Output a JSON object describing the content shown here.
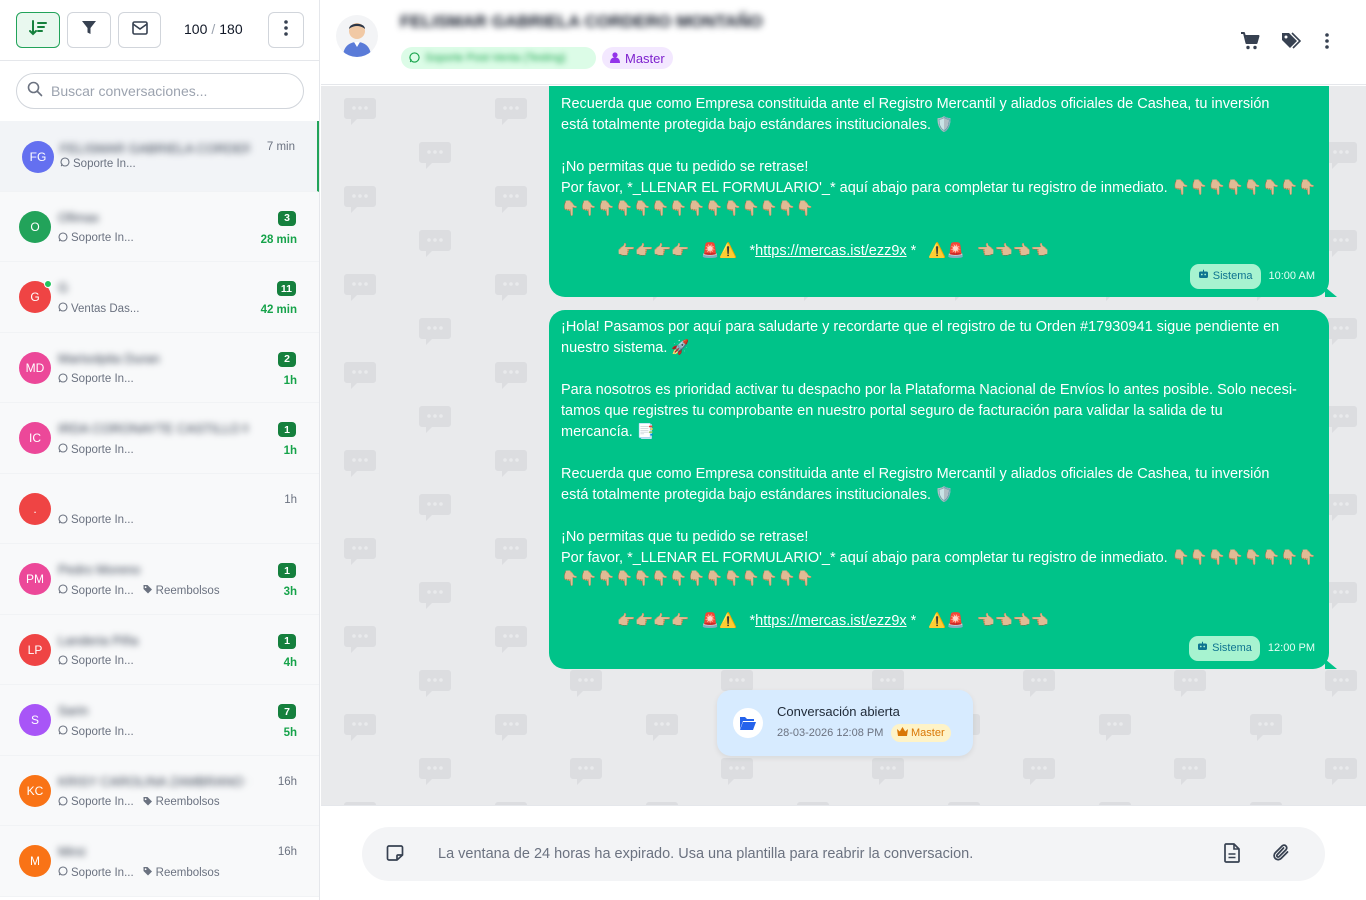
{
  "toolbar": {
    "count_shown": "100",
    "count_sep": "/",
    "count_total": "180",
    "icons": [
      "sort-icon",
      "filter-icon",
      "mail-icon",
      "more-vertical-icon"
    ]
  },
  "search": {
    "placeholder": "Buscar conversaciones..."
  },
  "conversations": [
    {
      "initials": "FG",
      "color": "#6470f0",
      "name": "FELISMAR GABRIELA CORDERO MONTAÑO",
      "channel": "Soporte In...",
      "time": "7 min",
      "unread": "",
      "tag": "",
      "online": false,
      "active": true
    },
    {
      "initials": "O",
      "color": "#22a35a",
      "name": "Ofimax",
      "channel": "Soporte In...",
      "time": "28 min",
      "unread": "3",
      "tag": "",
      "online": false,
      "active": false
    },
    {
      "initials": "G",
      "color": "#ef4444",
      "name": "G",
      "channel": "Ventas Das...",
      "time": "42 min",
      "unread": "11",
      "tag": "",
      "online": true,
      "active": false
    },
    {
      "initials": "MD",
      "color": "#ec4899",
      "name": "Marisolpita Duran",
      "channel": "Soporte In...",
      "time": "1h",
      "unread": "2",
      "tag": "",
      "online": false,
      "active": false
    },
    {
      "initials": "IC",
      "color": "#ec4899",
      "name": "IRDA CORONAYTE CASTILLO MIRE...",
      "channel": "Soporte In...",
      "time": "1h",
      "unread": "1",
      "tag": "",
      "online": false,
      "active": false
    },
    {
      "initials": ".",
      "color": "#ef4444",
      "name": "",
      "channel": "Soporte In...",
      "time": "1h",
      "unread": "",
      "tag": "",
      "online": false,
      "active": false
    },
    {
      "initials": "PM",
      "color": "#ec4899",
      "name": "Pedro Moreno",
      "channel": "Soporte In...",
      "time": "3h",
      "unread": "1",
      "tag": "Reembolsos",
      "online": false,
      "active": false
    },
    {
      "initials": "LP",
      "color": "#ef4444",
      "name": "Landeria Piña",
      "channel": "Soporte In...",
      "time": "4h",
      "unread": "1",
      "tag": "",
      "online": false,
      "active": false
    },
    {
      "initials": "S",
      "color": "#a855f7",
      "name": "Sarin",
      "channel": "Soporte In...",
      "time": "5h",
      "unread": "7",
      "tag": "",
      "online": false,
      "active": false
    },
    {
      "initials": "KC",
      "color": "#f97316",
      "name": "KRISY CAROLINA ZAMBRANO G...",
      "channel": "Soporte In...",
      "time": "16h",
      "unread": "",
      "tag": "Reembolsos",
      "online": false,
      "active": false
    },
    {
      "initials": "M",
      "color": "#f97316",
      "name": "Mirsi",
      "channel": "Soporte In...",
      "time": "16h",
      "unread": "",
      "tag": "Reembolsos",
      "online": false,
      "active": false
    }
  ],
  "header": {
    "name": "FELISMAR GABRIELA CORDERO MONTAÑO",
    "whatsapp_line": "Soporte Post-Venta (Testing)",
    "role": "Master",
    "icons": [
      "cart-icon",
      "tags-icon",
      "more-vertical-icon"
    ]
  },
  "messages": [
    {
      "lines_top": [
        "Recuerda que como Empresa constituida ante el Registro Mercantil y aliados oficiales de Cashea, tu inversión",
        "está totalmente protegida bajo estándares institucionales. 🛡️",
        "",
        "¡No permitas que tu pedido se retrase!",
        "Por favor, *_LLENAR EL FORMULARIO'_* aquí abajo para completar tu registro de inmediato. 👇🏼👇🏼👇🏼👇🏼👇🏼👇🏼👇🏼👇🏼",
        "👇🏼👇🏼👇🏼👇🏼👇🏼👇🏼👇🏼👇🏼👇🏼👇🏼👇🏼👇🏼👇🏼👇🏼"
      ],
      "link_prefix": "👉🏼👉🏼👉🏼👉🏼   🚨⚠️   *",
      "link": "https://mercas.ist/ezz9x",
      "link_suffix": " *   ⚠️🚨   👈🏼👈🏼👈🏼👈🏼",
      "sender": "Sistema",
      "time": "10:00 AM"
    },
    {
      "lines_top": [
        "¡Hola! Pasamos por aquí para saludarte y recordarte que el registro de tu Orden #17930941 sigue pendiente en",
        "nuestro sistema. 🚀",
        "",
        "Para nosotros es prioridad activar tu despacho por la Plataforma Nacional de Envíos lo antes posible. Solo necesi-",
        "tamos que registres tu comprobante en nuestro portal seguro de facturación para validar la salida de tu",
        "mercancía. 📑",
        "",
        "Recuerda que como Empresa constituida ante el Registro Mercantil y aliados oficiales de Cashea, tu inversión",
        "está totalmente protegida bajo estándares institucionales. 🛡️",
        "",
        "¡No permitas que tu pedido se retrase!",
        "Por favor, *_LLENAR EL FORMULARIO'_* aquí abajo para completar tu registro de inmediato. 👇🏼👇🏼👇🏼👇🏼👇🏼👇🏼👇🏼👇🏼",
        "👇🏼👇🏼👇🏼👇🏼👇🏼👇🏼👇🏼👇🏼👇🏼👇🏼👇🏼👇🏼👇🏼👇🏼"
      ],
      "link_prefix": "👉🏼👉🏼👉🏼👉🏼   🚨⚠️   *",
      "link": "https://mercas.ist/ezz9x",
      "link_suffix": " *   ⚠️🚨   👈🏼👈🏼👈🏼👈🏼",
      "sender": "Sistema",
      "time": "12:00 PM"
    }
  ],
  "event": {
    "title": "Conversación abierta",
    "date": "28-03-2026 12:08 PM",
    "role": "Master"
  },
  "composer": {
    "placeholder": "La ventana de 24 horas ha expirado. Usa una plantilla para reabrir la conversacion."
  }
}
